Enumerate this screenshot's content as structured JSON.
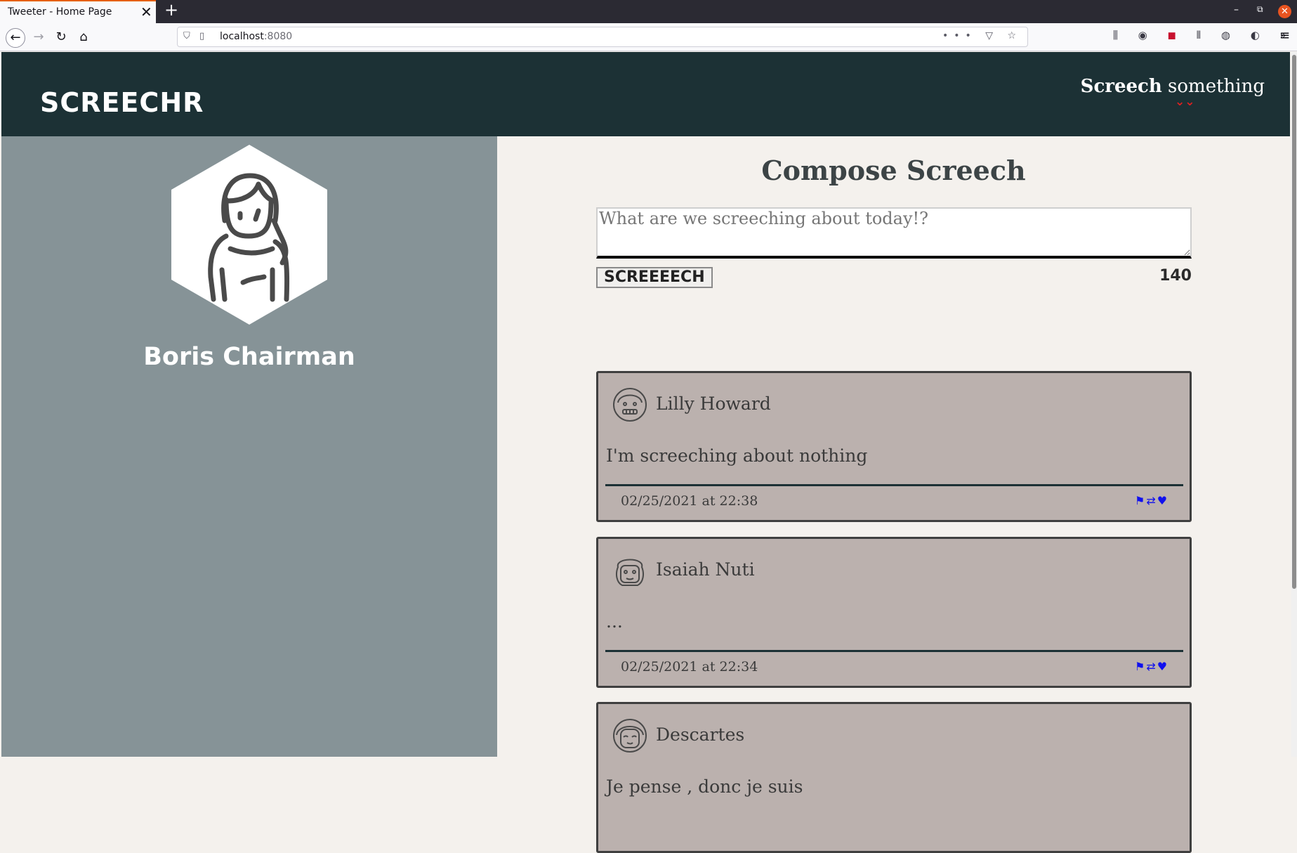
{
  "browser": {
    "tab_title": "Tweeter - Home Page",
    "tab_close": "✕",
    "new_tab": "+",
    "url_host": "localhost",
    "url_port": ":8080",
    "url_actions": "••• ▽ ☆",
    "extensions": "⫼ ◉",
    "extension_red": "◼",
    "extensions_more": "⫴ ◍ ◐ »",
    "menu": "≡",
    "win_min": "–",
    "win_max": "⧉",
    "win_close": "✕"
  },
  "header": {
    "logo": "SCREECHR",
    "screech_bold": "Screech",
    "screech_rest": " something",
    "chevron": "⌄⌄"
  },
  "sidebar": {
    "username": "Boris Chairman"
  },
  "compose": {
    "title": "Compose Screech",
    "placeholder": "What are we screeching about today!?",
    "submit_label": "SCREEEECH",
    "char_count": "140"
  },
  "posts": [
    {
      "author": "Lilly Howard",
      "text": "I'm screeching about nothing",
      "date": "02/25/2021 at 22:38"
    },
    {
      "author": "Isaiah Nuti",
      "text": "...",
      "date": "02/25/2021 at 22:34"
    },
    {
      "author": "Descartes",
      "text": "Je pense , donc je suis",
      "date": ""
    }
  ],
  "post_actions": {
    "flag": "⚑",
    "rescreech": "⇄",
    "like": "♥"
  },
  "colors": {
    "header_bg": "#1c3135",
    "sidebar_bg": "#869397",
    "page_bg": "#f4f1ed",
    "card_bg": "#bbb1ae",
    "accent_red": "#e02020",
    "action_blue": "#1010ee"
  }
}
